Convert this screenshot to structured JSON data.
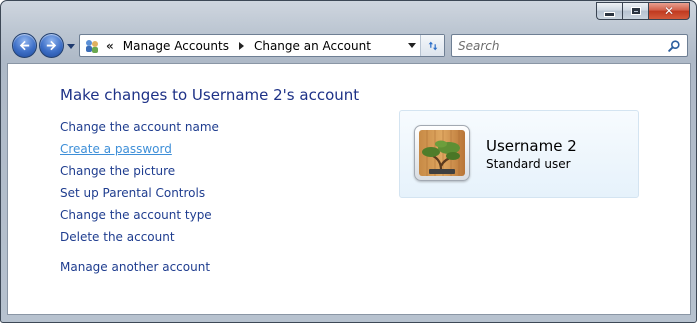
{
  "window": {
    "minimize_label": "minimize",
    "maximize_label": "maximize",
    "close_label": "close"
  },
  "toolbar": {
    "breadcrumb": [
      "Manage Accounts",
      "Change an Account"
    ],
    "overflow_glyph": "«"
  },
  "search": {
    "placeholder": "Search"
  },
  "main": {
    "title": "Make changes to Username 2's account",
    "tasks": [
      "Change the account name",
      "Create a password",
      "Change the picture",
      "Set up Parental Controls",
      "Change the account type",
      "Delete the account"
    ],
    "other_task": "Manage another account"
  },
  "account": {
    "name": "Username 2",
    "type": "Standard user",
    "avatar_icon": "bonsai-picture-icon"
  },
  "colors": {
    "link": "#1f3d8f",
    "link_hover": "#3e8fd8",
    "title": "#1e3287"
  }
}
